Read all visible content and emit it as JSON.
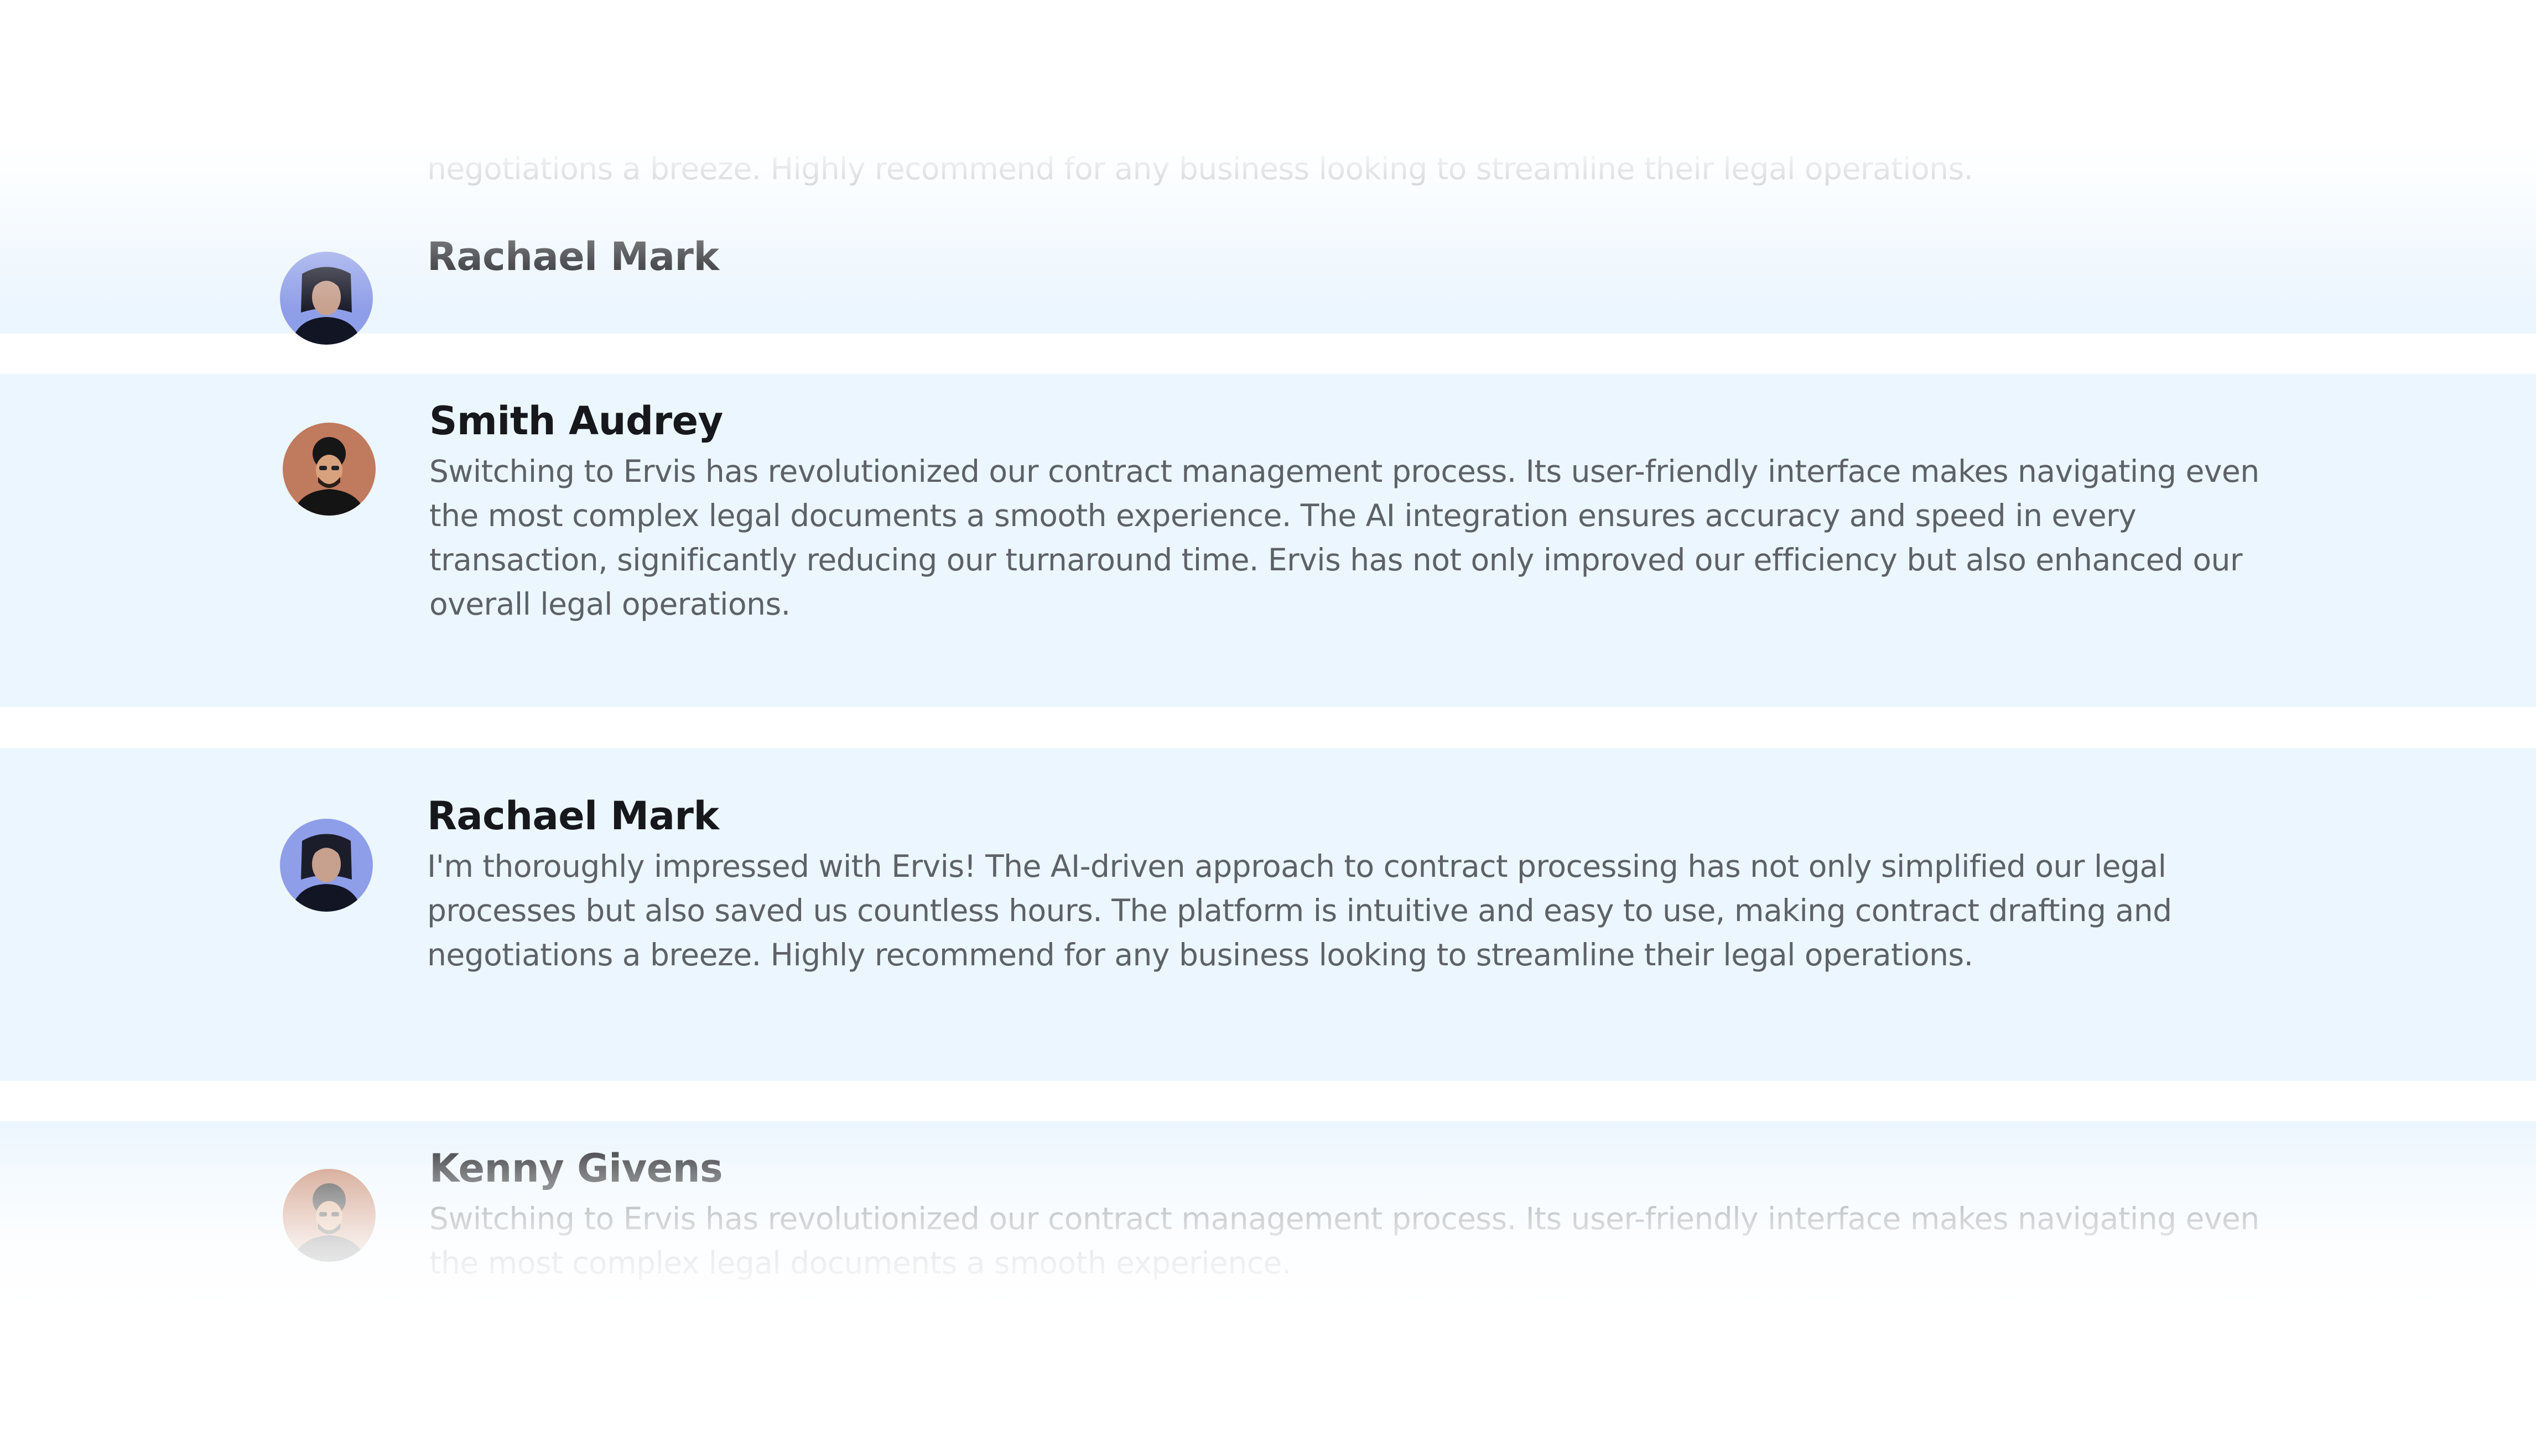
{
  "testimonials": [
    {
      "name": "Rachael Mark",
      "avatar_icon": "woman-portrait-avatar",
      "text": "I'm thoroughly impressed with Ervis! The AI-driven approach to contract processing has not only simplified our legal processes but also saved us countless hours. The platform is intuitive and easy to use, making contract drafting and negotiations a breeze. Highly recommend for any business looking to streamline their legal operations."
    },
    {
      "name": "Smith Audrey",
      "avatar_icon": "man-portrait-avatar",
      "text": "Switching to Ervis has revolutionized our contract management process. Its user-friendly interface makes navigating even the most complex legal documents a smooth experience. The AI integration ensures accuracy and speed in every transaction, significantly reducing our turnaround time. Ervis has not only improved our efficiency but also enhanced our overall legal operations."
    },
    {
      "name": "Rachael Mark",
      "avatar_icon": "woman-portrait-avatar",
      "text": "I'm thoroughly impressed with Ervis! The AI-driven approach to contract processing has not only simplified our legal processes but also saved us countless hours. The platform is intuitive and easy to use, making contract drafting and negotiations a breeze. Highly recommend for any business looking to streamline their legal operations."
    },
    {
      "name": "Kenny Givens",
      "avatar_icon": "man-portrait-avatar",
      "text": "Switching to Ervis has revolutionized our contract management process. Its user-friendly interface makes navigating even the most complex legal documents a smooth experience."
    }
  ],
  "colors": {
    "card_background": "#ecf6fe",
    "name_text": "#16181c",
    "body_text": "#5d6168",
    "page_background": "#ffffff"
  }
}
